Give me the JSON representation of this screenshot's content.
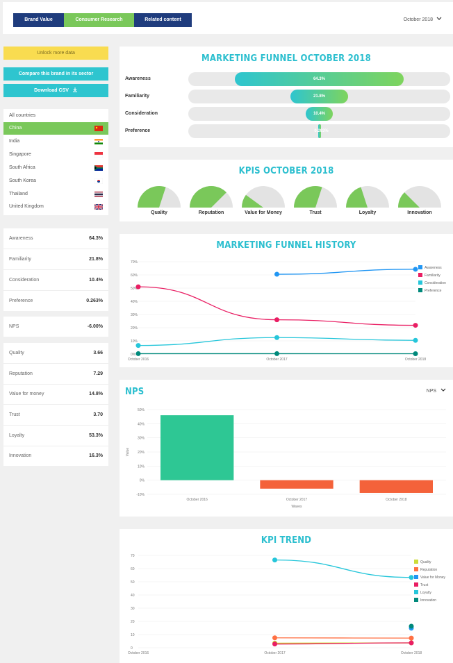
{
  "tabs": [
    "Brand Value",
    "Consumer Research",
    "Related content"
  ],
  "date_select": "October 2018",
  "sidebar": {
    "unlock": "Unlock more data",
    "compare": "Compare this brand in its sector",
    "download": "Download CSV",
    "all_countries": "All countries",
    "countries": [
      "China",
      "India",
      "Singapore",
      "South Africa",
      "South Korea",
      "Thailand",
      "United Kingdom"
    ],
    "metrics1": [
      {
        "label": "Awareness",
        "value": "64.3%"
      },
      {
        "label": "Familiarity",
        "value": "21.8%"
      },
      {
        "label": "Consideration",
        "value": "10.4%"
      },
      {
        "label": "Preference",
        "value": "0.263%"
      }
    ],
    "nps": {
      "label": "NPS",
      "value": "-6.00%"
    },
    "metrics2": [
      {
        "label": "Quality",
        "value": "3.66"
      },
      {
        "label": "Reputation",
        "value": "7.29"
      },
      {
        "label": "Value for money",
        "value": "14.8%"
      },
      {
        "label": "Trust",
        "value": "3.70"
      },
      {
        "label": "Loyalty",
        "value": "53.3%"
      },
      {
        "label": "Innovation",
        "value": "16.3%"
      }
    ]
  },
  "funnel": {
    "title": "MARKETING FUNNEL OCTOBER 2018",
    "rows": [
      {
        "label": "Awareness",
        "value": "64.3%",
        "fraction": 0.643
      },
      {
        "label": "Familiarity",
        "value": "21.8%",
        "fraction": 0.218
      },
      {
        "label": "Consideration",
        "value": "10.4%",
        "fraction": 0.104
      },
      {
        "label": "Preference",
        "value": "0.263%",
        "fraction": 0.0026
      }
    ]
  },
  "kpis": {
    "title": "KPIS OCTOBER 2018",
    "gauges": [
      {
        "label": "Quality",
        "fraction": 0.6
      },
      {
        "label": "Reputation",
        "fraction": 0.75
      },
      {
        "label": "Value for Money",
        "fraction": 0.2
      },
      {
        "label": "Trust",
        "fraction": 0.6
      },
      {
        "label": "Loyalty",
        "fraction": 0.4
      },
      {
        "label": "Innovation",
        "fraction": 0.25
      }
    ]
  },
  "history_title": "MARKETING FUNNEL HISTORY",
  "nps_title": "NPS",
  "nps_select": "NPS",
  "kpi_trend_title": "KPI TREND",
  "chart_data": [
    {
      "type": "line",
      "x": [
        "October 2016",
        "October 2017",
        "October 2018"
      ],
      "ylim": [
        0,
        70
      ],
      "yticks": [
        "0%",
        "10%",
        "20%",
        "30%",
        "40%",
        "50%",
        "60%",
        "70%"
      ],
      "series": [
        {
          "name": "Awareness",
          "color": "#2196f3",
          "values": [
            null,
            60.5,
            64.3
          ]
        },
        {
          "name": "Familiarity",
          "color": "#e91e63",
          "values": [
            51,
            26,
            21.8
          ]
        },
        {
          "name": "Consideration",
          "color": "#26c6da",
          "values": [
            6.5,
            12.5,
            10.4
          ]
        },
        {
          "name": "Preference",
          "color": "#00897b",
          "values": [
            0.3,
            0.3,
            0.263
          ]
        }
      ],
      "legend": "right"
    },
    {
      "type": "bar",
      "categories": [
        "October 2016",
        "October 2017",
        "October 2018"
      ],
      "values": [
        46,
        -6,
        -9
      ],
      "colors": [
        "#2ec794",
        "#f4623a",
        "#f4623a"
      ],
      "ylim": [
        -10,
        50
      ],
      "yticks": [
        "-10%",
        "0%",
        "10%",
        "20%",
        "30%",
        "40%",
        "50%"
      ],
      "ylabel": "Value",
      "xlabel": "Waves"
    },
    {
      "type": "line",
      "x": [
        "October 2016",
        "October 2017",
        "October 2018"
      ],
      "ylim": [
        0,
        70
      ],
      "yticks": [
        "0",
        "10",
        "20",
        "30",
        "40",
        "50",
        "60",
        "70"
      ],
      "series": [
        {
          "name": "Quality",
          "color": "#cddc39",
          "values": [
            null,
            3.5,
            3.66
          ]
        },
        {
          "name": "Reputation",
          "color": "#ff7043",
          "values": [
            null,
            7.5,
            7.29
          ]
        },
        {
          "name": "Value for Money",
          "color": "#2196f3",
          "values": [
            null,
            null,
            14.8
          ]
        },
        {
          "name": "Trust",
          "color": "#e91e63",
          "values": [
            null,
            2.8,
            3.7
          ]
        },
        {
          "name": "Loyalty",
          "color": "#26c6da",
          "values": [
            null,
            66.5,
            53.3
          ]
        },
        {
          "name": "Innovation",
          "color": "#00897b",
          "values": [
            null,
            null,
            16.3
          ]
        }
      ],
      "legend": "right"
    }
  ]
}
